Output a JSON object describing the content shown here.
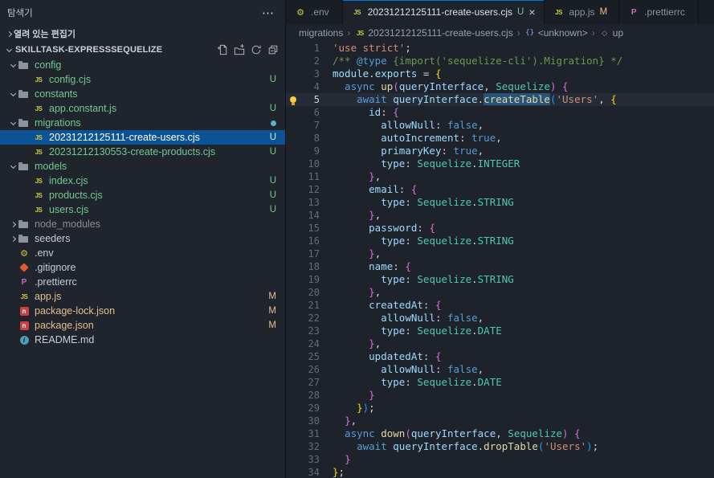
{
  "sidebar": {
    "title": "탐색기",
    "open_editors_label": "열려 있는 편집기",
    "workspace_label": "SKILLTASK-EXPRESSSEQUELIZE",
    "actions": [
      "new-file",
      "new-folder",
      "refresh",
      "collapse-all"
    ],
    "tree": [
      {
        "label": "config",
        "kind": "folder",
        "icon": "folder",
        "depth": 0,
        "expanded": true,
        "git": "untracked"
      },
      {
        "label": "config.cjs",
        "kind": "file",
        "icon": "js",
        "depth": 1,
        "git": "untracked",
        "badge": "U"
      },
      {
        "label": "constants",
        "kind": "folder",
        "icon": "folder",
        "depth": 0,
        "expanded": true,
        "git": "untracked"
      },
      {
        "label": "app.constant.js",
        "kind": "file",
        "icon": "js",
        "depth": 1,
        "git": "untracked",
        "badge": "U"
      },
      {
        "label": "migrations",
        "kind": "folder",
        "icon": "folder",
        "depth": 0,
        "expanded": true,
        "git": "untracked",
        "dot": true
      },
      {
        "label": "20231212125111-create-users.cjs",
        "kind": "file",
        "icon": "js",
        "depth": 1,
        "git": "untracked",
        "badge": "U",
        "selected": true
      },
      {
        "label": "20231212130553-create-products.cjs",
        "kind": "file",
        "icon": "js",
        "depth": 1,
        "git": "untracked",
        "badge": "U"
      },
      {
        "label": "models",
        "kind": "folder",
        "icon": "folder",
        "depth": 0,
        "expanded": true,
        "git": "untracked"
      },
      {
        "label": "index.cjs",
        "kind": "file",
        "icon": "js",
        "depth": 1,
        "git": "untracked",
        "badge": "U"
      },
      {
        "label": "products.cjs",
        "kind": "file",
        "icon": "js",
        "depth": 1,
        "git": "untracked",
        "badge": "U"
      },
      {
        "label": "users.cjs",
        "kind": "file",
        "icon": "js",
        "depth": 1,
        "git": "untracked",
        "badge": "U"
      },
      {
        "label": "node_modules",
        "kind": "folder",
        "icon": "folder",
        "depth": 0,
        "expanded": false,
        "git": "ignored"
      },
      {
        "label": "seeders",
        "kind": "folder",
        "icon": "folder",
        "depth": 0,
        "expanded": false
      },
      {
        "label": ".env",
        "kind": "file",
        "icon": "gear",
        "depth": 0
      },
      {
        "label": ".gitignore",
        "kind": "file",
        "icon": "git",
        "depth": 0
      },
      {
        "label": ".prettierrc",
        "kind": "file",
        "icon": "prettier",
        "depth": 0
      },
      {
        "label": "app.js",
        "kind": "file",
        "icon": "js",
        "depth": 0,
        "git": "modified",
        "badge": "M"
      },
      {
        "label": "package-lock.json",
        "kind": "file",
        "icon": "npm",
        "depth": 0,
        "git": "modified",
        "badge": "M"
      },
      {
        "label": "package.json",
        "kind": "file",
        "icon": "npm",
        "depth": 0,
        "git": "modified",
        "badge": "M"
      },
      {
        "label": "README.md",
        "kind": "file",
        "icon": "info",
        "depth": 0
      }
    ]
  },
  "tabs": [
    {
      "label": ".env",
      "icon": "gear",
      "active": false
    },
    {
      "label": "20231212125111-create-users.cjs",
      "icon": "js",
      "active": true,
      "badge": "U",
      "badge_git": "untracked",
      "close": "×"
    },
    {
      "label": "app.js",
      "icon": "js",
      "active": false,
      "badge": "M",
      "badge_git": "modified"
    },
    {
      "label": ".prettierrc",
      "icon": "prettier",
      "active": false
    }
  ],
  "breadcrumbs": [
    {
      "label": "migrations"
    },
    {
      "label": "20231212125111-create-users.cjs",
      "icon": "js"
    },
    {
      "label": "<unknown>",
      "icon": "symbol-object"
    },
    {
      "label": "up",
      "icon": "symbol-method"
    }
  ],
  "editor": {
    "current_line": 5,
    "lightbulb_line": 5,
    "lines": [
      {
        "n": 1,
        "tokens": [
          [
            "'use strict'",
            "str"
          ],
          [
            ";",
            "pln"
          ]
        ]
      },
      {
        "n": 2,
        "tokens": [
          [
            "/** ",
            "cmt"
          ],
          [
            "@type",
            "kw"
          ],
          [
            " {import('sequelize-cli').Migration} */",
            "cmt"
          ]
        ]
      },
      {
        "n": 3,
        "tokens": [
          [
            "module",
            "var"
          ],
          [
            ".",
            "pln"
          ],
          [
            "exports",
            "var"
          ],
          [
            " = ",
            "pln"
          ],
          [
            "{",
            "b1"
          ]
        ]
      },
      {
        "n": 4,
        "tokens": [
          [
            "  ",
            "pln"
          ],
          [
            "async",
            "kw"
          ],
          [
            " ",
            "pln"
          ],
          [
            "up",
            "fn"
          ],
          [
            "(",
            "b2"
          ],
          [
            "queryInterface",
            "var"
          ],
          [
            ", ",
            "pln"
          ],
          [
            "Sequelize",
            "cls"
          ],
          [
            ")",
            "b2"
          ],
          [
            " ",
            "pln"
          ],
          [
            "{",
            "b2"
          ]
        ]
      },
      {
        "n": 5,
        "tokens": [
          [
            "    ",
            "pln"
          ],
          [
            "await",
            "kw"
          ],
          [
            " ",
            "pln"
          ],
          [
            "queryInterface",
            "var"
          ],
          [
            ".",
            "pln"
          ],
          [
            "createTable",
            "fn hl"
          ],
          [
            "(",
            "b3"
          ],
          [
            "'Users'",
            "str"
          ],
          [
            ", ",
            "pln"
          ],
          [
            "{",
            "b1"
          ]
        ]
      },
      {
        "n": 6,
        "tokens": [
          [
            "      ",
            "pln"
          ],
          [
            "id",
            "var"
          ],
          [
            ": ",
            "pln"
          ],
          [
            "{",
            "b2"
          ]
        ]
      },
      {
        "n": 7,
        "tokens": [
          [
            "        ",
            "pln"
          ],
          [
            "allowNull",
            "var"
          ],
          [
            ": ",
            "pln"
          ],
          [
            "false",
            "kw"
          ],
          [
            ",",
            "pln"
          ]
        ]
      },
      {
        "n": 8,
        "tokens": [
          [
            "        ",
            "pln"
          ],
          [
            "autoIncrement",
            "var"
          ],
          [
            ": ",
            "pln"
          ],
          [
            "true",
            "kw"
          ],
          [
            ",",
            "pln"
          ]
        ]
      },
      {
        "n": 9,
        "tokens": [
          [
            "        ",
            "pln"
          ],
          [
            "primaryKey",
            "var"
          ],
          [
            ": ",
            "pln"
          ],
          [
            "true",
            "kw"
          ],
          [
            ",",
            "pln"
          ]
        ]
      },
      {
        "n": 10,
        "tokens": [
          [
            "        ",
            "pln"
          ],
          [
            "type",
            "var"
          ],
          [
            ": ",
            "pln"
          ],
          [
            "Sequelize",
            "cls"
          ],
          [
            ".",
            "pln"
          ],
          [
            "INTEGER",
            "cls"
          ]
        ]
      },
      {
        "n": 11,
        "tokens": [
          [
            "      ",
            "pln"
          ],
          [
            "}",
            "b2"
          ],
          [
            ",",
            "pln"
          ]
        ]
      },
      {
        "n": 12,
        "tokens": [
          [
            "      ",
            "pln"
          ],
          [
            "email",
            "var"
          ],
          [
            ": ",
            "pln"
          ],
          [
            "{",
            "b2"
          ]
        ]
      },
      {
        "n": 13,
        "tokens": [
          [
            "        ",
            "pln"
          ],
          [
            "type",
            "var"
          ],
          [
            ": ",
            "pln"
          ],
          [
            "Sequelize",
            "cls"
          ],
          [
            ".",
            "pln"
          ],
          [
            "STRING",
            "cls"
          ]
        ]
      },
      {
        "n": 14,
        "tokens": [
          [
            "      ",
            "pln"
          ],
          [
            "}",
            "b2"
          ],
          [
            ",",
            "pln"
          ]
        ]
      },
      {
        "n": 15,
        "tokens": [
          [
            "      ",
            "pln"
          ],
          [
            "password",
            "var"
          ],
          [
            ": ",
            "pln"
          ],
          [
            "{",
            "b2"
          ]
        ]
      },
      {
        "n": 16,
        "tokens": [
          [
            "        ",
            "pln"
          ],
          [
            "type",
            "var"
          ],
          [
            ": ",
            "pln"
          ],
          [
            "Sequelize",
            "cls"
          ],
          [
            ".",
            "pln"
          ],
          [
            "STRING",
            "cls"
          ]
        ]
      },
      {
        "n": 17,
        "tokens": [
          [
            "      ",
            "pln"
          ],
          [
            "}",
            "b2"
          ],
          [
            ",",
            "pln"
          ]
        ]
      },
      {
        "n": 18,
        "tokens": [
          [
            "      ",
            "pln"
          ],
          [
            "name",
            "var"
          ],
          [
            ": ",
            "pln"
          ],
          [
            "{",
            "b2"
          ]
        ]
      },
      {
        "n": 19,
        "tokens": [
          [
            "        ",
            "pln"
          ],
          [
            "type",
            "var"
          ],
          [
            ": ",
            "pln"
          ],
          [
            "Sequelize",
            "cls"
          ],
          [
            ".",
            "pln"
          ],
          [
            "STRING",
            "cls"
          ]
        ]
      },
      {
        "n": 20,
        "tokens": [
          [
            "      ",
            "pln"
          ],
          [
            "}",
            "b2"
          ],
          [
            ",",
            "pln"
          ]
        ]
      },
      {
        "n": 21,
        "tokens": [
          [
            "      ",
            "pln"
          ],
          [
            "createdAt",
            "var"
          ],
          [
            ": ",
            "pln"
          ],
          [
            "{",
            "b2"
          ]
        ]
      },
      {
        "n": 22,
        "tokens": [
          [
            "        ",
            "pln"
          ],
          [
            "allowNull",
            "var"
          ],
          [
            ": ",
            "pln"
          ],
          [
            "false",
            "kw"
          ],
          [
            ",",
            "pln"
          ]
        ]
      },
      {
        "n": 23,
        "tokens": [
          [
            "        ",
            "pln"
          ],
          [
            "type",
            "var"
          ],
          [
            ": ",
            "pln"
          ],
          [
            "Sequelize",
            "cls"
          ],
          [
            ".",
            "pln"
          ],
          [
            "DATE",
            "cls"
          ]
        ]
      },
      {
        "n": 24,
        "tokens": [
          [
            "      ",
            "pln"
          ],
          [
            "}",
            "b2"
          ],
          [
            ",",
            "pln"
          ]
        ]
      },
      {
        "n": 25,
        "tokens": [
          [
            "      ",
            "pln"
          ],
          [
            "updatedAt",
            "var"
          ],
          [
            ": ",
            "pln"
          ],
          [
            "{",
            "b2"
          ]
        ]
      },
      {
        "n": 26,
        "tokens": [
          [
            "        ",
            "pln"
          ],
          [
            "allowNull",
            "var"
          ],
          [
            ": ",
            "pln"
          ],
          [
            "false",
            "kw"
          ],
          [
            ",",
            "pln"
          ]
        ]
      },
      {
        "n": 27,
        "tokens": [
          [
            "        ",
            "pln"
          ],
          [
            "type",
            "var"
          ],
          [
            ": ",
            "pln"
          ],
          [
            "Sequelize",
            "cls"
          ],
          [
            ".",
            "pln"
          ],
          [
            "DATE",
            "cls"
          ]
        ]
      },
      {
        "n": 28,
        "tokens": [
          [
            "      ",
            "pln"
          ],
          [
            "}",
            "b2"
          ]
        ]
      },
      {
        "n": 29,
        "tokens": [
          [
            "    ",
            "pln"
          ],
          [
            "}",
            "b1"
          ],
          [
            ")",
            "b3"
          ],
          [
            ";",
            "pln"
          ]
        ]
      },
      {
        "n": 30,
        "tokens": [
          [
            "  ",
            "pln"
          ],
          [
            "}",
            "b2"
          ],
          [
            ",",
            "pln"
          ]
        ]
      },
      {
        "n": 31,
        "tokens": [
          [
            "  ",
            "pln"
          ],
          [
            "async",
            "kw"
          ],
          [
            " ",
            "pln"
          ],
          [
            "down",
            "fn"
          ],
          [
            "(",
            "b2"
          ],
          [
            "queryInterface",
            "var"
          ],
          [
            ", ",
            "pln"
          ],
          [
            "Sequelize",
            "cls"
          ],
          [
            ")",
            "b2"
          ],
          [
            " ",
            "pln"
          ],
          [
            "{",
            "b2"
          ]
        ]
      },
      {
        "n": 32,
        "tokens": [
          [
            "    ",
            "pln"
          ],
          [
            "await",
            "kw"
          ],
          [
            " ",
            "pln"
          ],
          [
            "queryInterface",
            "var"
          ],
          [
            ".",
            "pln"
          ],
          [
            "dropTable",
            "fn"
          ],
          [
            "(",
            "b3"
          ],
          [
            "'Users'",
            "str"
          ],
          [
            ")",
            "b3"
          ],
          [
            ";",
            "pln"
          ]
        ]
      },
      {
        "n": 33,
        "tokens": [
          [
            "  ",
            "pln"
          ],
          [
            "}",
            "b2"
          ]
        ]
      },
      {
        "n": 34,
        "tokens": [
          [
            "}",
            "b1"
          ],
          [
            ";",
            "pln"
          ]
        ]
      }
    ]
  },
  "colors": {
    "accent_blue": "#0078d4",
    "git_untracked": "#73c991",
    "git_modified": "#e2c08d",
    "git_ignored": "#8c8c8c",
    "selected_row": "#0b5394",
    "string": "#ce9178",
    "comment": "#6a9955",
    "keyword": "#569cd6",
    "function": "#dcdcaa",
    "variable": "#9cdcfe",
    "class": "#4ec9b0",
    "bracket_gold": "#ffd700",
    "bracket_pink": "#da70d6",
    "bracket_blue": "#179fff"
  }
}
